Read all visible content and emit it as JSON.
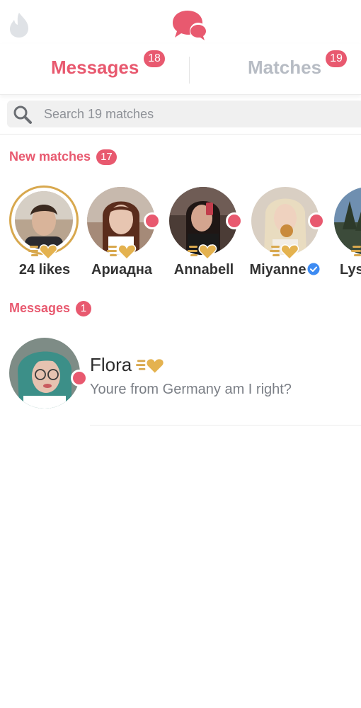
{
  "tabs": [
    {
      "label": "Messages",
      "badge": "18"
    },
    {
      "label": "Matches",
      "badge": "19"
    }
  ],
  "search": {
    "placeholder": "Search 19 matches"
  },
  "new_matches": {
    "title": "New matches",
    "count": "17",
    "items": [
      {
        "name": "24 likes"
      },
      {
        "name": "Ариадна"
      },
      {
        "name": "Annabell"
      },
      {
        "name": "Miyanne"
      },
      {
        "name": "Lys"
      }
    ]
  },
  "messages": {
    "title": "Messages",
    "count": "1",
    "items": [
      {
        "name": "Flora",
        "preview": "Youre from Germany am I right?"
      }
    ]
  },
  "colors": {
    "accent": "#e8596f",
    "gold": "#d8a84e",
    "inactive": "#b7bcc4",
    "verified": "#3d8bf2"
  },
  "icons": [
    "flame-icon",
    "chat-bubbles-icon",
    "search-icon",
    "gold-heart-icon",
    "verified-badge-icon"
  ]
}
